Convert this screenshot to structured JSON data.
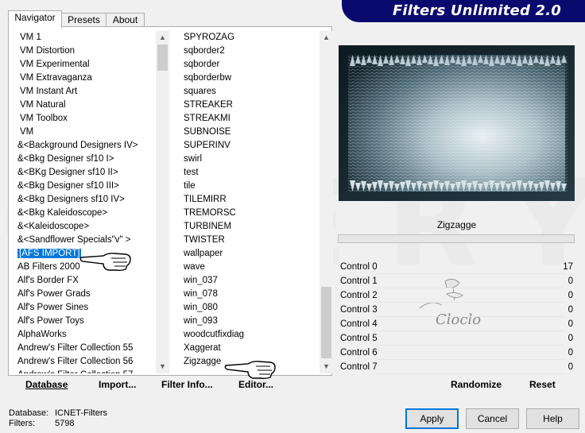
{
  "tabs": [
    {
      "label": "Navigator"
    },
    {
      "label": "Presets"
    },
    {
      "label": "About"
    }
  ],
  "banner": {
    "title": "Filters Unlimited 2.0"
  },
  "categories": [
    {
      "label": "VM 1"
    },
    {
      "label": "VM Distortion"
    },
    {
      "label": "VM Experimental"
    },
    {
      "label": "VM Extravaganza"
    },
    {
      "label": "VM Instant Art"
    },
    {
      "label": "VM Natural"
    },
    {
      "label": "VM Toolbox"
    },
    {
      "label": "VM"
    },
    {
      "label": "&<Background Designers IV>"
    },
    {
      "label": "&<Bkg Designer sf10 I>"
    },
    {
      "label": "&<BKg Designer sf10 II>"
    },
    {
      "label": "&<Bkg Designer sf10 III>"
    },
    {
      "label": "&<Bkg Designers sf10 IV>"
    },
    {
      "label": "&<Bkg Kaleidoscope>"
    },
    {
      "label": "&<Kaleidoscope>"
    },
    {
      "label": "&<Sandflower Specials\"v\" >"
    },
    {
      "label": "[AFS IMPORT]"
    },
    {
      "label": "AB Filters 2000"
    },
    {
      "label": "Alf's Border FX"
    },
    {
      "label": "Alf's Power Grads"
    },
    {
      "label": "Alf's Power Sines"
    },
    {
      "label": "Alf's Power Toys"
    },
    {
      "label": "AlphaWorks"
    },
    {
      "label": "Andrew's Filter Collection 55"
    },
    {
      "label": "Andrew's Filter Collection 56"
    },
    {
      "label": "Andrew's Filter Collection 57"
    }
  ],
  "filters": [
    {
      "label": "SPYROZAG"
    },
    {
      "label": "sqborder2"
    },
    {
      "label": "sqborder"
    },
    {
      "label": "sqborderbw"
    },
    {
      "label": "squares"
    },
    {
      "label": "STREAKER"
    },
    {
      "label": "STREAKMI"
    },
    {
      "label": "SUBNOISE"
    },
    {
      "label": "SUPERINV"
    },
    {
      "label": "swirl"
    },
    {
      "label": "test"
    },
    {
      "label": "tile"
    },
    {
      "label": "TILEMIRR"
    },
    {
      "label": "TREMORSC"
    },
    {
      "label": "TURBINEM"
    },
    {
      "label": "TWISTER"
    },
    {
      "label": "wallpaper"
    },
    {
      "label": "wave"
    },
    {
      "label": "win_037"
    },
    {
      "label": "win_078"
    },
    {
      "label": "win_080"
    },
    {
      "label": "win_093"
    },
    {
      "label": "woodcutfixdiag"
    },
    {
      "label": "Xaggerat"
    },
    {
      "label": "Zigzagge"
    }
  ],
  "selected_category": "[AFS IMPORT]",
  "selected_filter": "Zigzagge",
  "left_buttons": {
    "database": "Database",
    "import": "Import...",
    "filter_info": "Filter Info...",
    "editor": "Editor..."
  },
  "preview": {
    "filter_name": "Zigzagge",
    "watermark_text": "Cloclo"
  },
  "controls": [
    {
      "label": "Control 0",
      "value": "17"
    },
    {
      "label": "Control 1",
      "value": "0"
    },
    {
      "label": "Control 2",
      "value": "0"
    },
    {
      "label": "Control 3",
      "value": "0"
    },
    {
      "label": "Control 4",
      "value": "0"
    },
    {
      "label": "Control 5",
      "value": "0"
    },
    {
      "label": "Control 6",
      "value": "0"
    },
    {
      "label": "Control 7",
      "value": "0"
    }
  ],
  "right_buttons": {
    "randomize": "Randomize",
    "reset": "Reset"
  },
  "status": {
    "database_label": "Database:",
    "database_value": "ICNET-Filters",
    "filters_label": "Filters:",
    "filters_value": "5798"
  },
  "dialog_buttons": {
    "apply": "Apply",
    "cancel": "Cancel",
    "help": "Help"
  },
  "colors": {
    "banner": "#0a0a6e",
    "selection": "#0078d7"
  }
}
